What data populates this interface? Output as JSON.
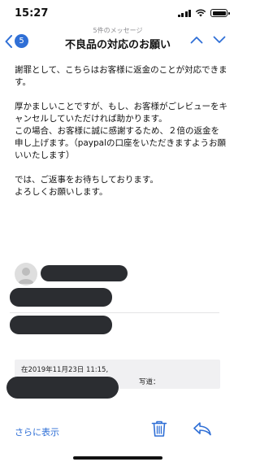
{
  "status_bar": {
    "time": "15:27"
  },
  "nav": {
    "back_count": "5",
    "subtitle": "5件のメッセージ",
    "title": "不良品の対応のお願い"
  },
  "message": {
    "paragraphs": [
      "謝罪として、こちらはお客様に返金のことが対応できます。",
      "",
      "厚かましいことですが、もし、お客様がごレビューをキャンセルしていただければ助かります。",
      "この場合、お客様に誠に感謝するため、２倍の返金を申し上げます。（paypalの口座をいただきますようお願いいたします）",
      "",
      "では、ご返事をお待ちしております。",
      "よろしくお願いします。"
    ]
  },
  "quote": {
    "date_line": "在2019年11月23日 11:15,",
    "wrote": "写道："
  },
  "toolbar": {
    "more_label": "さらに表示"
  },
  "colors": {
    "accent": "#2f6fd6",
    "redaction": "#2b2d31"
  }
}
